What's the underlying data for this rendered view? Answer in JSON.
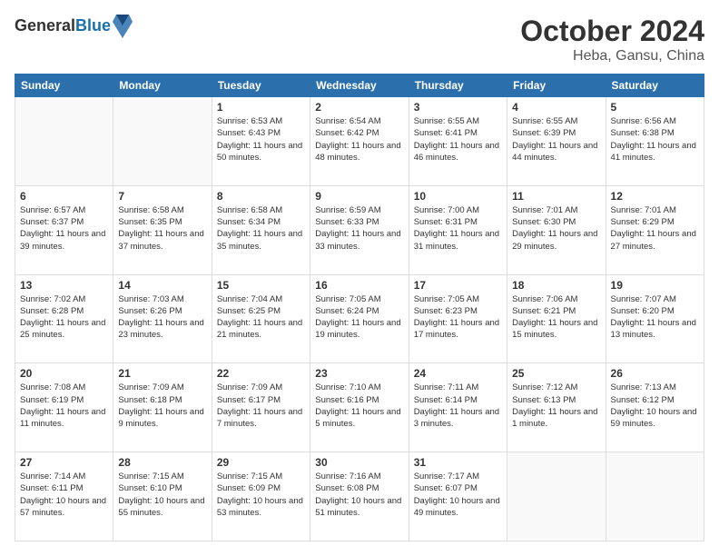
{
  "header": {
    "logo_general": "General",
    "logo_blue": "Blue",
    "month": "October 2024",
    "location": "Heba, Gansu, China"
  },
  "days_of_week": [
    "Sunday",
    "Monday",
    "Tuesday",
    "Wednesday",
    "Thursday",
    "Friday",
    "Saturday"
  ],
  "weeks": [
    [
      {
        "day": "",
        "empty": true
      },
      {
        "day": "",
        "empty": true
      },
      {
        "day": "1",
        "sunrise": "6:53 AM",
        "sunset": "6:43 PM",
        "daylight": "11 hours and 50 minutes."
      },
      {
        "day": "2",
        "sunrise": "6:54 AM",
        "sunset": "6:42 PM",
        "daylight": "11 hours and 48 minutes."
      },
      {
        "day": "3",
        "sunrise": "6:55 AM",
        "sunset": "6:41 PM",
        "daylight": "11 hours and 46 minutes."
      },
      {
        "day": "4",
        "sunrise": "6:55 AM",
        "sunset": "6:39 PM",
        "daylight": "11 hours and 44 minutes."
      },
      {
        "day": "5",
        "sunrise": "6:56 AM",
        "sunset": "6:38 PM",
        "daylight": "11 hours and 41 minutes."
      }
    ],
    [
      {
        "day": "6",
        "sunrise": "6:57 AM",
        "sunset": "6:37 PM",
        "daylight": "11 hours and 39 minutes."
      },
      {
        "day": "7",
        "sunrise": "6:58 AM",
        "sunset": "6:35 PM",
        "daylight": "11 hours and 37 minutes."
      },
      {
        "day": "8",
        "sunrise": "6:58 AM",
        "sunset": "6:34 PM",
        "daylight": "11 hours and 35 minutes."
      },
      {
        "day": "9",
        "sunrise": "6:59 AM",
        "sunset": "6:33 PM",
        "daylight": "11 hours and 33 minutes."
      },
      {
        "day": "10",
        "sunrise": "7:00 AM",
        "sunset": "6:31 PM",
        "daylight": "11 hours and 31 minutes."
      },
      {
        "day": "11",
        "sunrise": "7:01 AM",
        "sunset": "6:30 PM",
        "daylight": "11 hours and 29 minutes."
      },
      {
        "day": "12",
        "sunrise": "7:01 AM",
        "sunset": "6:29 PM",
        "daylight": "11 hours and 27 minutes."
      }
    ],
    [
      {
        "day": "13",
        "sunrise": "7:02 AM",
        "sunset": "6:28 PM",
        "daylight": "11 hours and 25 minutes."
      },
      {
        "day": "14",
        "sunrise": "7:03 AM",
        "sunset": "6:26 PM",
        "daylight": "11 hours and 23 minutes."
      },
      {
        "day": "15",
        "sunrise": "7:04 AM",
        "sunset": "6:25 PM",
        "daylight": "11 hours and 21 minutes."
      },
      {
        "day": "16",
        "sunrise": "7:05 AM",
        "sunset": "6:24 PM",
        "daylight": "11 hours and 19 minutes."
      },
      {
        "day": "17",
        "sunrise": "7:05 AM",
        "sunset": "6:23 PM",
        "daylight": "11 hours and 17 minutes."
      },
      {
        "day": "18",
        "sunrise": "7:06 AM",
        "sunset": "6:21 PM",
        "daylight": "11 hours and 15 minutes."
      },
      {
        "day": "19",
        "sunrise": "7:07 AM",
        "sunset": "6:20 PM",
        "daylight": "11 hours and 13 minutes."
      }
    ],
    [
      {
        "day": "20",
        "sunrise": "7:08 AM",
        "sunset": "6:19 PM",
        "daylight": "11 hours and 11 minutes."
      },
      {
        "day": "21",
        "sunrise": "7:09 AM",
        "sunset": "6:18 PM",
        "daylight": "11 hours and 9 minutes."
      },
      {
        "day": "22",
        "sunrise": "7:09 AM",
        "sunset": "6:17 PM",
        "daylight": "11 hours and 7 minutes."
      },
      {
        "day": "23",
        "sunrise": "7:10 AM",
        "sunset": "6:16 PM",
        "daylight": "11 hours and 5 minutes."
      },
      {
        "day": "24",
        "sunrise": "7:11 AM",
        "sunset": "6:14 PM",
        "daylight": "11 hours and 3 minutes."
      },
      {
        "day": "25",
        "sunrise": "7:12 AM",
        "sunset": "6:13 PM",
        "daylight": "11 hours and 1 minute."
      },
      {
        "day": "26",
        "sunrise": "7:13 AM",
        "sunset": "6:12 PM",
        "daylight": "10 hours and 59 minutes."
      }
    ],
    [
      {
        "day": "27",
        "sunrise": "7:14 AM",
        "sunset": "6:11 PM",
        "daylight": "10 hours and 57 minutes."
      },
      {
        "day": "28",
        "sunrise": "7:15 AM",
        "sunset": "6:10 PM",
        "daylight": "10 hours and 55 minutes."
      },
      {
        "day": "29",
        "sunrise": "7:15 AM",
        "sunset": "6:09 PM",
        "daylight": "10 hours and 53 minutes."
      },
      {
        "day": "30",
        "sunrise": "7:16 AM",
        "sunset": "6:08 PM",
        "daylight": "10 hours and 51 minutes."
      },
      {
        "day": "31",
        "sunrise": "7:17 AM",
        "sunset": "6:07 PM",
        "daylight": "10 hours and 49 minutes."
      },
      {
        "day": "",
        "empty": true
      },
      {
        "day": "",
        "empty": true
      }
    ]
  ]
}
